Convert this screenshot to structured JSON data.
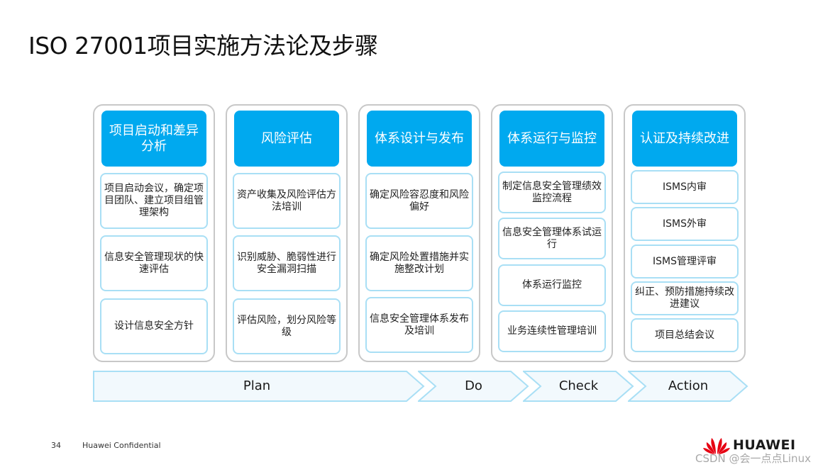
{
  "slide": {
    "title": "ISO 27001项目实施方法论及步骤",
    "page_number": "34",
    "confidential": "Huawei  Confidential",
    "brand": "HUAWEI",
    "watermark": "CSDN @会一点点Linux"
  },
  "colors": {
    "header_fill": "#00a9ef",
    "item_border": "#a9dff5",
    "column_border": "#c8c8c8",
    "phase_fill": "#f2f9fd",
    "phase_border": "#a9dff5",
    "logo_red": "#e60012"
  },
  "columns": [
    {
      "header": "项目启动和差异分析",
      "items": [
        "项目启动会议，确定项目团队、建立项目组管理架构",
        "信息安全管理现状的快速评估",
        "设计信息安全方针"
      ]
    },
    {
      "header": "风险评估",
      "items": [
        "资产收集及风险评估方法培训",
        "识别威胁、脆弱性进行安全漏洞扫描",
        "评估风险，划分风险等级"
      ]
    },
    {
      "header": "体系设计与发布",
      "items": [
        "确定风险容忍度和风险偏好",
        "确定风险处置措施并实施整改计划",
        "信息安全管理体系发布及培训"
      ]
    },
    {
      "header": "体系运行与监控",
      "items": [
        "制定信息安全管理绩效监控流程",
        "信息安全管理体系试运行",
        "体系运行监控",
        "业务连续性管理培训"
      ]
    },
    {
      "header": "认证及持续改进",
      "items": [
        "ISMS内审",
        "ISMS外审",
        "ISMS管理评审",
        "纠正、预防措施持续改进建议",
        "项目总结会议"
      ]
    }
  ],
  "phases": [
    {
      "label": "Plan"
    },
    {
      "label": "Do"
    },
    {
      "label": "Check"
    },
    {
      "label": "Action"
    }
  ]
}
